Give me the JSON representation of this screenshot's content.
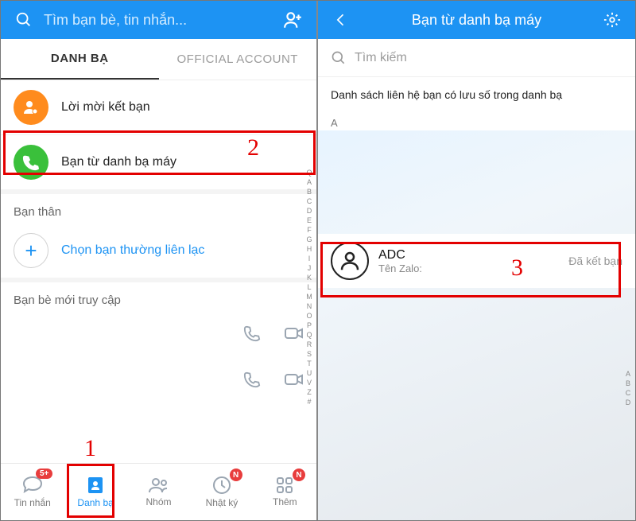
{
  "left": {
    "header": {
      "search_placeholder": "Tìm bạn bè, tin nhắn..."
    },
    "tabs": {
      "contacts": "DANH BẠ",
      "official": "OFFICIAL ACCOUNT"
    },
    "rows": {
      "friend_requests": "Lời mời kết bạn",
      "phone_contacts": "Bạn từ danh bạ máy"
    },
    "sections": {
      "close_friends": "Bạn thân",
      "choose_frequent": "Chọn bạn thường liên lạc",
      "recent_access": "Bạn bè mới truy cập"
    },
    "nav": {
      "messages": {
        "label": "Tin nhắn",
        "badge": "5+"
      },
      "contacts": {
        "label": "Danh bạ"
      },
      "groups": {
        "label": "Nhóm"
      },
      "diary": {
        "label": "Nhật ký",
        "badge": "N"
      },
      "more": {
        "label": "Thêm",
        "badge": "N"
      }
    },
    "alpha": [
      "Q",
      "A",
      "B",
      "C",
      "D",
      "E",
      "F",
      "G",
      "H",
      "I",
      "J",
      "K",
      "L",
      "M",
      "N",
      "O",
      "P",
      "Q",
      "R",
      "S",
      "T",
      "U",
      "V",
      "Z",
      "#"
    ]
  },
  "right": {
    "header": {
      "title": "Bạn từ danh bạ máy"
    },
    "search_placeholder": "Tìm kiếm",
    "description": "Danh sách liên hệ bạn có lưu số trong danh bạ",
    "letter": "A",
    "contact": {
      "name": "ADC",
      "zalo_label": "Tên Zalo:",
      "status": "Đã kết bạn"
    },
    "alpha": [
      "A",
      "B",
      "C",
      "D"
    ]
  },
  "callouts": {
    "n1": "1",
    "n2": "2",
    "n3": "3"
  }
}
